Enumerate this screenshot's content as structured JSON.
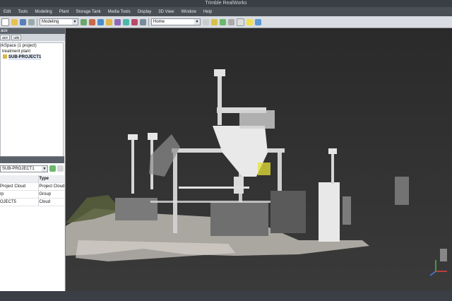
{
  "window": {
    "title": "Trimble RealWorks"
  },
  "menu": [
    "Edit",
    "Tools",
    "Modeling",
    "Plant",
    "Storage Tank",
    "Media Tools",
    "Display",
    "3D View",
    "Window",
    "Help"
  ],
  "toolbar": {
    "mode_combo": "Modeling",
    "view_combo": "Home"
  },
  "workspace": {
    "title": "ace",
    "tabs": [
      "ace",
      "ude"
    ],
    "tree": [
      "rkSpace (1 project)",
      "treatment plant",
      "SUB-PROJECT1"
    ]
  },
  "properties": {
    "combo": "SUB-PROJECT1",
    "headers": [
      "",
      "Type"
    ],
    "rows": [
      {
        "name": "Project Cloud",
        "type": "Project Cloud"
      },
      {
        "name": "rp",
        "type": "Group"
      },
      {
        "name": "OJECT5",
        "type": "Cloud"
      }
    ]
  },
  "colors": {
    "background": "#2b2b2b",
    "title_bar": "#3a3f45",
    "menu_bar": "#4a4f56",
    "toolbar": "#d9dde2",
    "panel": "#eceef1",
    "selection_marker": "#e7e23a"
  },
  "icons": [
    "new-icon",
    "open-icon",
    "save-icon",
    "undo-icon",
    "rotate-icon",
    "pan-icon",
    "zoom-icon",
    "fit-icon",
    "select-icon",
    "cloud-icon",
    "axis-icon",
    "project-icon"
  ]
}
